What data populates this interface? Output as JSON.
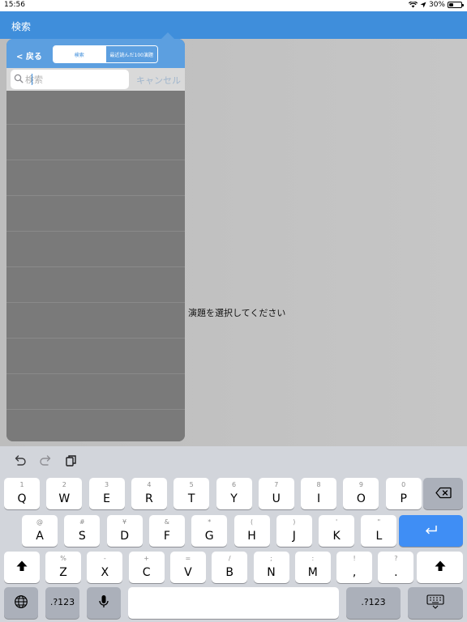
{
  "status_bar": {
    "time": "15:56",
    "battery_percent": "30%",
    "battery_level": 0.3
  },
  "nav_bar": {
    "title": "検索"
  },
  "main": {
    "placeholder": "演題を選択してください"
  },
  "popover": {
    "back_label": "< 戻る",
    "segments": [
      {
        "label": "検索",
        "selected": true
      },
      {
        "label": "最近読んだ100演題",
        "selected": false
      }
    ],
    "search": {
      "placeholder": "検索",
      "value": ""
    },
    "cancel_label": "キャンセル",
    "result_rows": 10
  },
  "keyboard": {
    "toolbar": [
      "undo-icon",
      "redo-icon",
      "paste-icon"
    ],
    "row1": [
      {
        "sub": "1",
        "main": "Q"
      },
      {
        "sub": "2",
        "main": "W"
      },
      {
        "sub": "3",
        "main": "E"
      },
      {
        "sub": "4",
        "main": "R"
      },
      {
        "sub": "5",
        "main": "T"
      },
      {
        "sub": "6",
        "main": "Y"
      },
      {
        "sub": "7",
        "main": "U"
      },
      {
        "sub": "8",
        "main": "I"
      },
      {
        "sub": "9",
        "main": "O"
      },
      {
        "sub": "0",
        "main": "P"
      }
    ],
    "row2": [
      {
        "sub": "@",
        "main": "A"
      },
      {
        "sub": "#",
        "main": "S"
      },
      {
        "sub": "¥",
        "main": "D"
      },
      {
        "sub": "&",
        "main": "F"
      },
      {
        "sub": "*",
        "main": "G"
      },
      {
        "sub": "(",
        "main": "H"
      },
      {
        "sub": ")",
        "main": "J"
      },
      {
        "sub": "'",
        "main": "K"
      },
      {
        "sub": "\"",
        "main": "L"
      }
    ],
    "row3": [
      {
        "sub": "%",
        "main": "Z"
      },
      {
        "sub": "-",
        "main": "X"
      },
      {
        "sub": "+",
        "main": "C"
      },
      {
        "sub": "=",
        "main": "V"
      },
      {
        "sub": "/",
        "main": "B"
      },
      {
        "sub": ";",
        "main": "N"
      },
      {
        "sub": ":",
        "main": "M"
      },
      {
        "sub": "!",
        "main": ","
      },
      {
        "sub": "?",
        "main": "."
      }
    ],
    "numbers_label": ".?123"
  },
  "colors": {
    "accent": "#3f8edb",
    "popover_header": "#5c9fe0",
    "return_key": "#3f8ef5"
  }
}
